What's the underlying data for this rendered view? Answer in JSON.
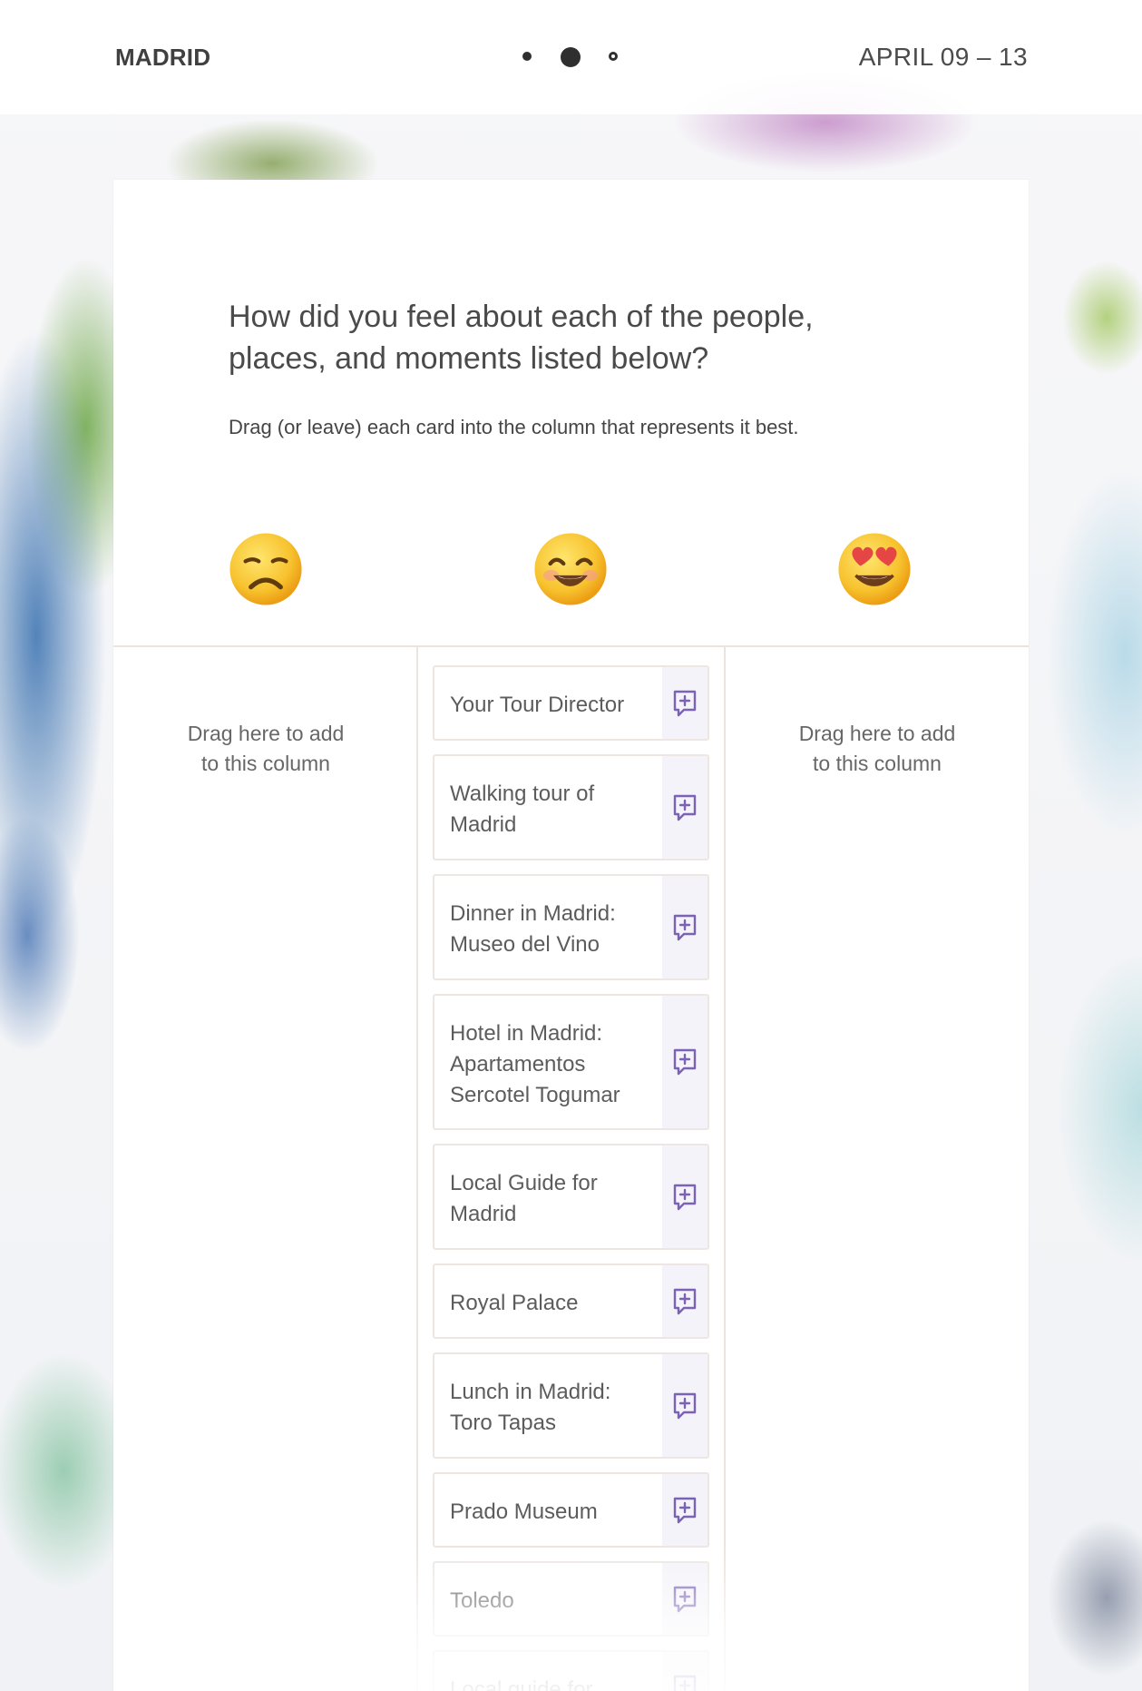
{
  "header": {
    "title": "MADRID",
    "dates": "APRIL 09 – 13",
    "progress": {
      "total_steps": 3,
      "current_step": 2
    }
  },
  "question": {
    "title": "How did you feel about each of the people,\nplaces, and moments listed below?",
    "instruction": "Drag (or leave) each card into the column that represents it best."
  },
  "columns": [
    {
      "emoji": "disappointed-face-icon"
    },
    {
      "emoji": "smiling-face-icon"
    },
    {
      "emoji": "heart-eyes-face-icon"
    }
  ],
  "drop_hints": {
    "left": "Drag here to add\nto this column",
    "right": "Drag here to add\nto this column"
  },
  "cards": [
    {
      "label": "Your Tour Director"
    },
    {
      "label": "Walking tour of\nMadrid"
    },
    {
      "label": "Dinner in Madrid:\nMuseo del Vino"
    },
    {
      "label": "Hotel in Madrid:\nApartamentos\nSercotel Togumar"
    },
    {
      "label": "Local Guide for\nMadrid"
    },
    {
      "label": "Royal Palace"
    },
    {
      "label": "Lunch in Madrid:\nToro Tapas"
    },
    {
      "label": "Prado Museum"
    },
    {
      "label": "Toledo"
    },
    {
      "label": "Local guide for"
    }
  ],
  "colors": {
    "accent": "#7a62b5",
    "divider": "#ece4df"
  }
}
